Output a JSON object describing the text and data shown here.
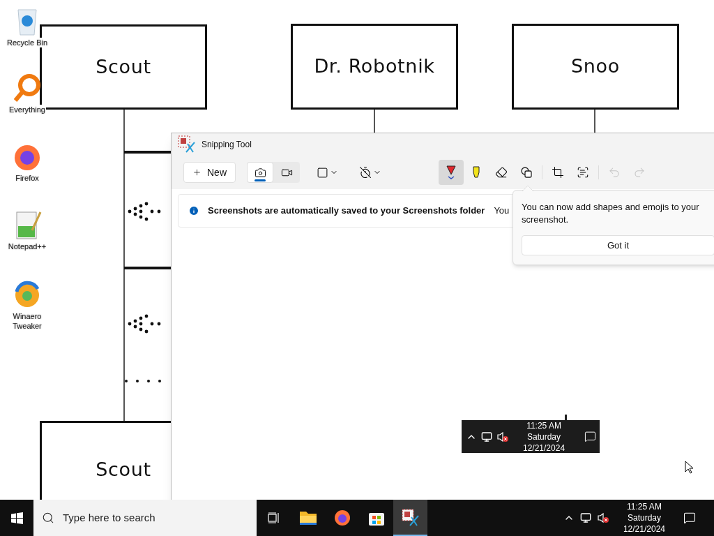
{
  "desktop_icons": [
    {
      "kind": "recycle",
      "label": "Recycle Bin"
    },
    {
      "kind": "everything",
      "label": "Everything"
    },
    {
      "kind": "firefox",
      "label": "Firefox"
    },
    {
      "kind": "notepad",
      "label": "Notepad++"
    },
    {
      "kind": "winaero",
      "label": "Winaero Tweaker"
    }
  ],
  "diagram": {
    "nodes": [
      {
        "label": "Scout"
      },
      {
        "label": "Dr. Robotnik"
      },
      {
        "label": "Snoo"
      },
      {
        "label": "Scout"
      }
    ]
  },
  "snipping_tool": {
    "title": "Snipping Tool",
    "new_button": "New",
    "modes": [
      {
        "kind": "photo",
        "selected": true
      },
      {
        "kind": "video",
        "selected": false
      }
    ],
    "tools": [
      {
        "kind": "pen",
        "selected": true
      },
      {
        "kind": "highlighter",
        "selected": false
      },
      {
        "kind": "eraser",
        "selected": false
      },
      {
        "kind": "shapes",
        "selected": false
      },
      {
        "kind": "crop",
        "selected": false
      },
      {
        "kind": "text",
        "selected": false
      }
    ],
    "undo": {
      "disabled": true
    },
    "redo": {
      "disabled": true
    },
    "info": {
      "message": "Screenshots are automatically saved to your Screenshots folder",
      "extra": "You"
    },
    "tip": {
      "text": "You can now add shapes and emojis to your screenshot.",
      "button": "Got it"
    },
    "capture": {
      "time": "11:25 AM",
      "day": "Saturday",
      "date": "12/21/2024"
    }
  },
  "taskbar": {
    "search_placeholder": "Type here to search",
    "apps": [
      {
        "kind": "explorer",
        "selected": false
      },
      {
        "kind": "firefox",
        "selected": false
      },
      {
        "kind": "store",
        "selected": false
      },
      {
        "kind": "snipping",
        "selected": true
      }
    ],
    "clock": {
      "time": "11:25 AM",
      "day": "Saturday",
      "date": "12/21/2024"
    }
  }
}
